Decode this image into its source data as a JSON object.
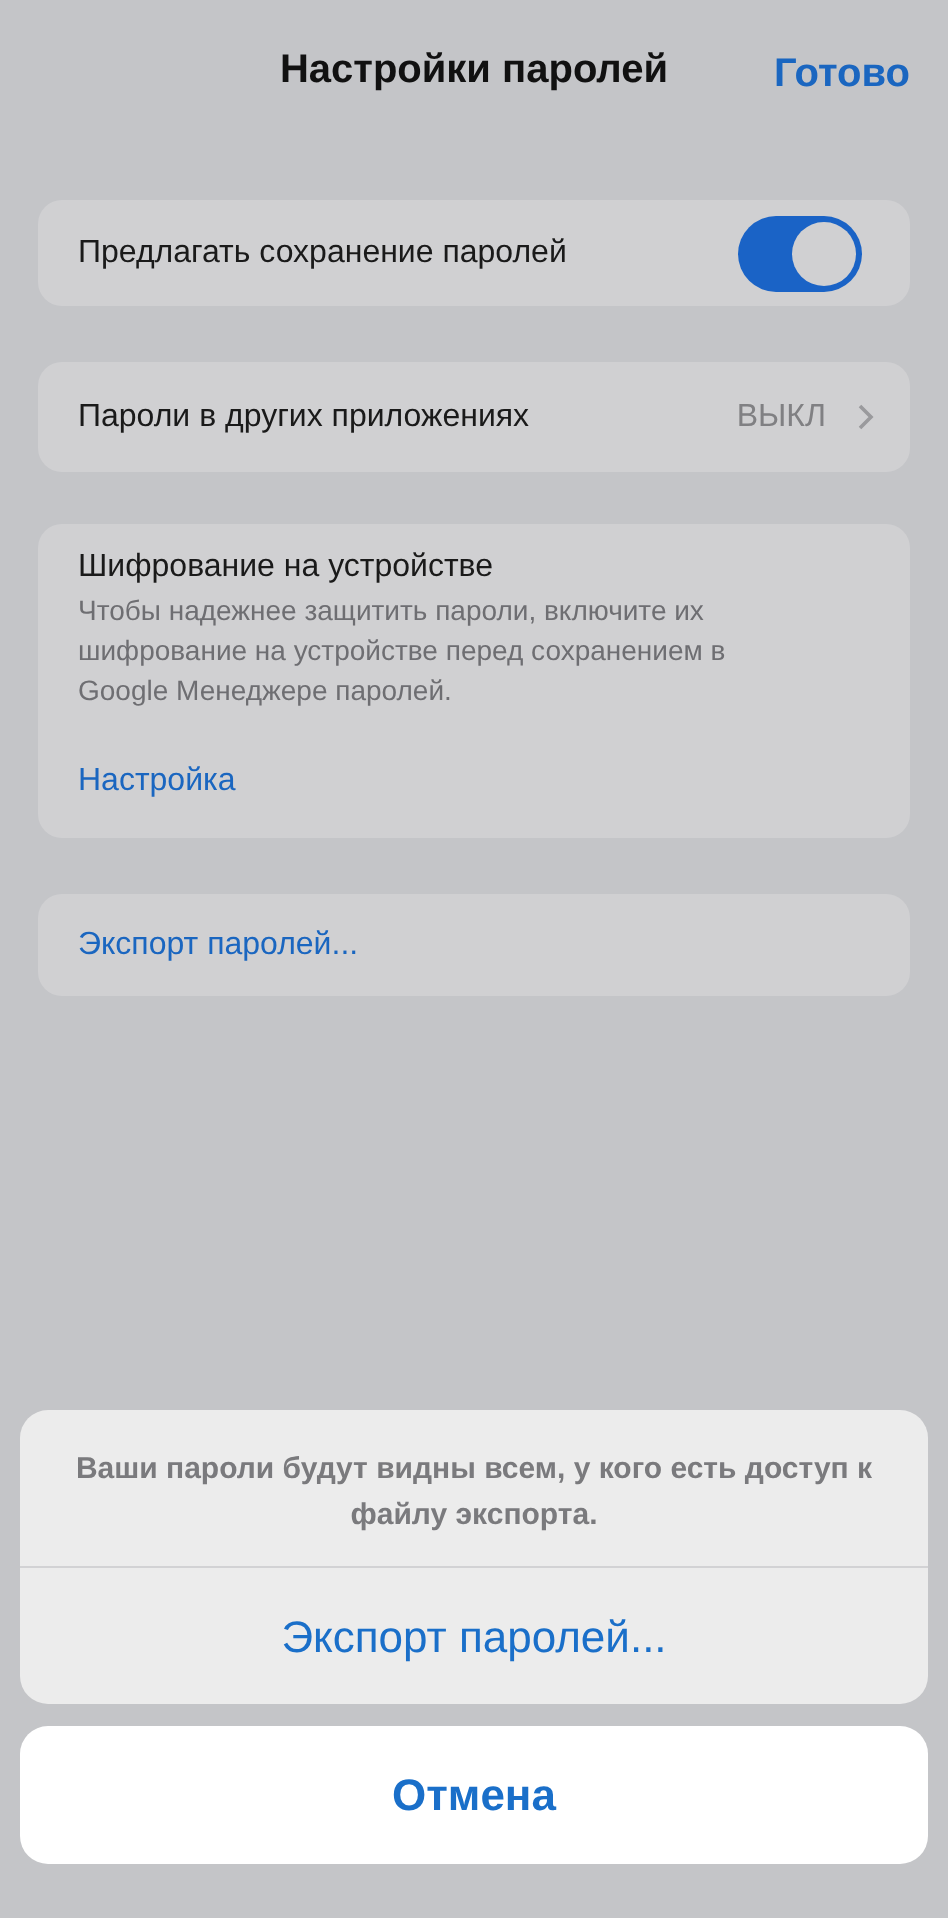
{
  "header": {
    "title": "Настройки паролей",
    "done": "Готово"
  },
  "sections": [
    {
      "kind": "toggle",
      "label": "Предлагать сохранение паролей",
      "on": true
    },
    {
      "kind": "link",
      "label": "Пароли в других приложениях",
      "value": "ВЫКЛ"
    },
    {
      "kind": "info",
      "title": "Шифрование на устройстве",
      "description": "Чтобы надежнее защитить пароли, включите их шифрование на устройстве перед сохранением в Google Менеджере паролей.",
      "action": "Настройка"
    },
    {
      "kind": "action",
      "label": "Экспорт паролей..."
    }
  ],
  "action_sheet": {
    "message": "Ваши пароли будут видны всем, у кого есть доступ к файлу экспорта.",
    "actions": [
      "Экспорт паролей..."
    ],
    "cancel": "Отмена"
  }
}
